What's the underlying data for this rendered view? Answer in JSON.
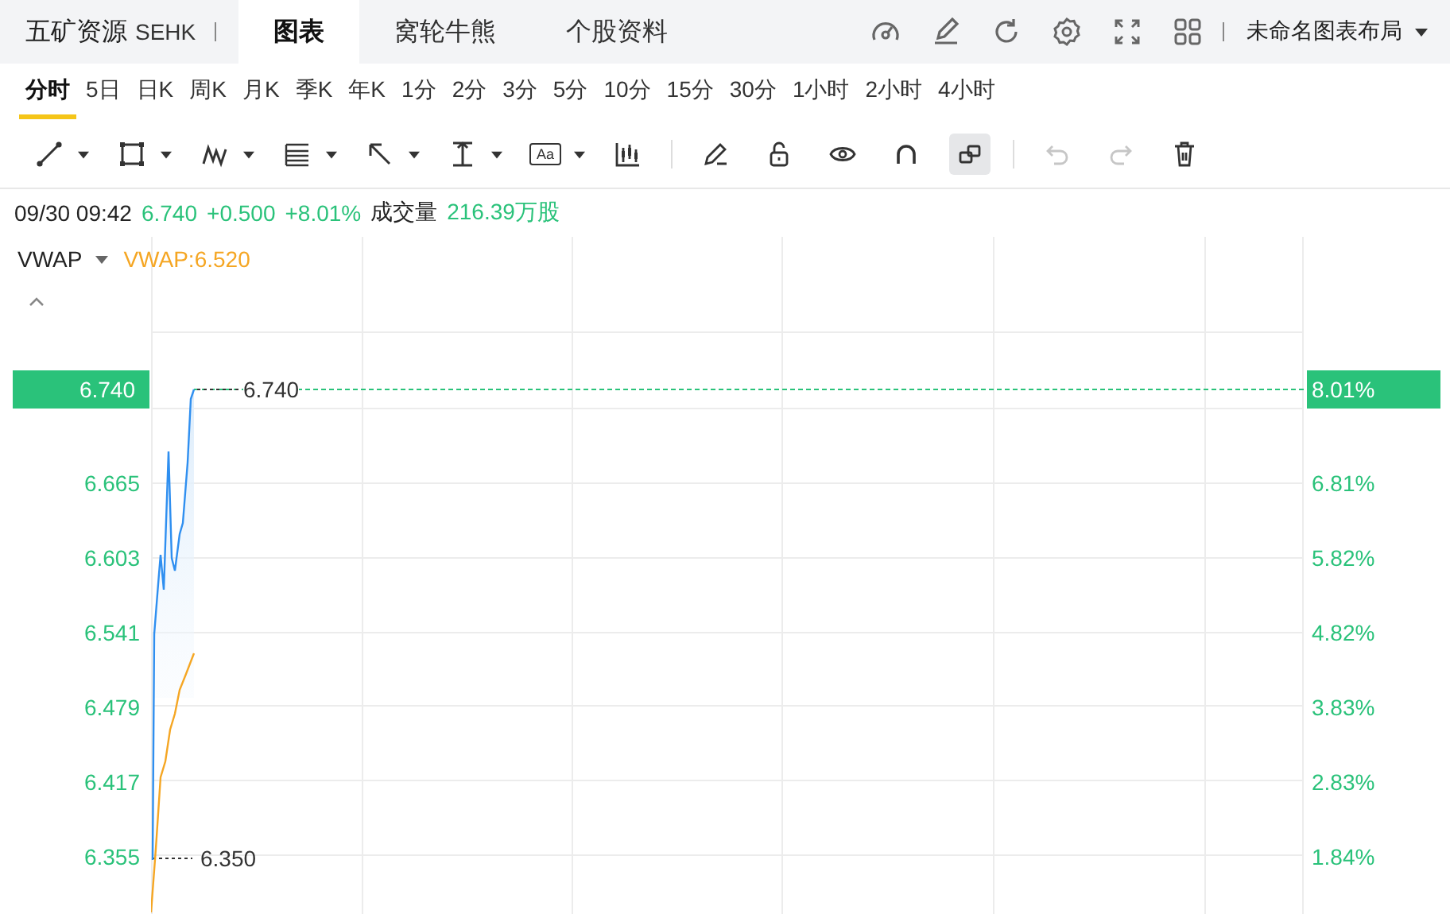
{
  "header": {
    "stock_name": "五矿资源",
    "exchange": "SEHK",
    "tabs": [
      {
        "label": "图表",
        "selected": true
      },
      {
        "label": "窝轮牛熊",
        "selected": false
      },
      {
        "label": "个股资料",
        "selected": false
      }
    ],
    "layout_menu": "未命名图表布局"
  },
  "periods": [
    {
      "label": "分时",
      "selected": true
    },
    {
      "label": "5日",
      "selected": false
    },
    {
      "label": "日K",
      "selected": false
    },
    {
      "label": "周K",
      "selected": false
    },
    {
      "label": "月K",
      "selected": false
    },
    {
      "label": "季K",
      "selected": false
    },
    {
      "label": "年K",
      "selected": false
    },
    {
      "label": "1分",
      "selected": false
    },
    {
      "label": "2分",
      "selected": false
    },
    {
      "label": "3分",
      "selected": false
    },
    {
      "label": "5分",
      "selected": false
    },
    {
      "label": "10分",
      "selected": false
    },
    {
      "label": "15分",
      "selected": false
    },
    {
      "label": "30分",
      "selected": false
    },
    {
      "label": "1小时",
      "selected": false
    },
    {
      "label": "2小时",
      "selected": false
    },
    {
      "label": "4小时",
      "selected": false
    }
  ],
  "toolbar": {
    "text_tool_label": "Aa",
    "items": [
      {
        "kind": "line",
        "dropdown": true,
        "selected": false,
        "disabled": false
      },
      {
        "kind": "rect",
        "dropdown": true,
        "selected": false,
        "disabled": false
      },
      {
        "kind": "wave",
        "dropdown": true,
        "selected": false,
        "disabled": false
      },
      {
        "kind": "fib",
        "dropdown": true,
        "selected": false,
        "disabled": false
      },
      {
        "kind": "arrow",
        "dropdown": true,
        "selected": false,
        "disabled": false
      },
      {
        "kind": "measure",
        "dropdown": true,
        "selected": false,
        "disabled": false
      },
      {
        "kind": "text",
        "dropdown": true,
        "selected": false,
        "disabled": false
      },
      {
        "kind": "candles",
        "dropdown": false,
        "selected": false,
        "disabled": false
      },
      {
        "kind": "sep"
      },
      {
        "kind": "pencil",
        "dropdown": false,
        "selected": false,
        "disabled": false
      },
      {
        "kind": "lock",
        "dropdown": false,
        "selected": false,
        "disabled": false
      },
      {
        "kind": "eye",
        "dropdown": false,
        "selected": false,
        "disabled": false
      },
      {
        "kind": "magnet",
        "dropdown": false,
        "selected": false,
        "disabled": false
      },
      {
        "kind": "layers",
        "dropdown": false,
        "selected": true,
        "disabled": false
      },
      {
        "kind": "sep"
      },
      {
        "kind": "undo",
        "dropdown": false,
        "selected": false,
        "disabled": true
      },
      {
        "kind": "redo",
        "dropdown": false,
        "selected": false,
        "disabled": true
      },
      {
        "kind": "trash",
        "dropdown": false,
        "selected": false,
        "disabled": false
      }
    ]
  },
  "quote": {
    "time": "09/30 09:42",
    "price": "6.740",
    "change": "+0.500",
    "change_pct": "+8.01%",
    "volume_label": "成交量",
    "volume": "216.39万股"
  },
  "indicator": {
    "name": "VWAP",
    "value": "VWAP:6.520"
  },
  "chart": {
    "price_axis": [
      "6.665",
      "6.603",
      "6.541",
      "6.479",
      "6.417",
      "6.355"
    ],
    "percent_axis": [
      "6.81%",
      "5.82%",
      "4.82%",
      "3.83%",
      "2.83%",
      "1.84%"
    ],
    "last_price_tag": "6.740",
    "last_pct_tag": "8.01%",
    "high_label": "6.740",
    "low_label": "6.350"
  }
}
